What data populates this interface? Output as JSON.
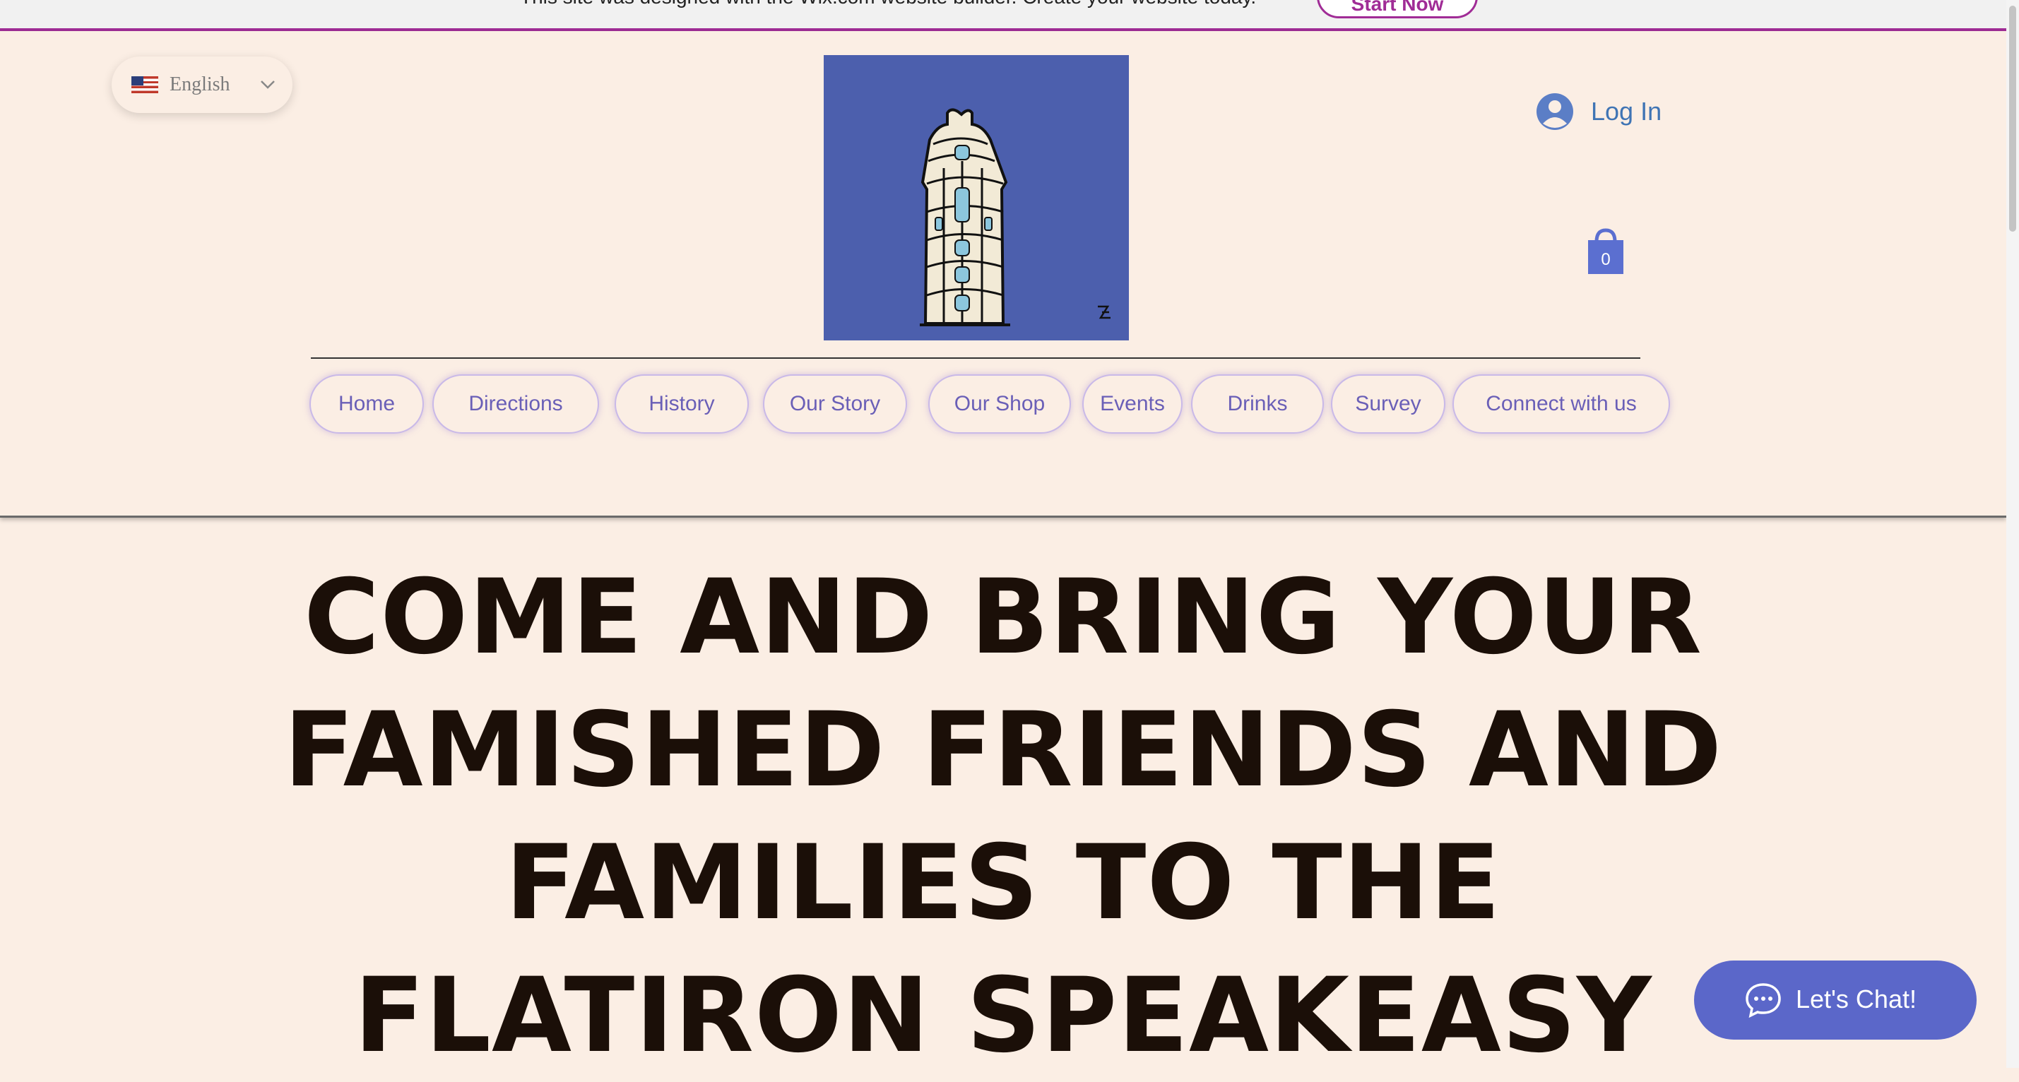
{
  "banner": {
    "text": "This site was designed with the Wix.com website builder. Create your website today.",
    "button_label": "Start Now"
  },
  "header": {
    "language": {
      "selected": "English"
    },
    "login_label": "Log In",
    "cart_count": "0",
    "nav_items": [
      "Home",
      "Directions",
      "History",
      "Our Story",
      "Our Shop",
      "Events",
      "Drinks",
      "Survey",
      "Connect with us"
    ]
  },
  "hero": {
    "lines": [
      "COME AND BRING YOUR",
      "FAMISHED FRIENDS AND",
      "FAMILIES TO THE",
      "FLATIRON SPEAKEASY"
    ]
  },
  "chat": {
    "label": "Let's Chat!"
  },
  "colors": {
    "page_bg": "#fbeee4",
    "brand_magenta": "#a02c96",
    "nav_text": "#6a5fb7",
    "logo_bg": "#4c5fad",
    "chat_bg": "#5b67c9",
    "login_blue": "#3f74b4"
  },
  "icons": [
    "us-flag-icon",
    "chevron-down-icon",
    "user-avatar-icon",
    "shopping-bag-icon",
    "chat-bubble-icon",
    "flatiron-building-logo"
  ]
}
